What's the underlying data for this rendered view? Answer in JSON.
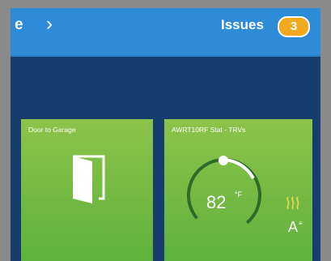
{
  "header": {
    "crumb_text": "e",
    "chevron": "›",
    "issues_label": "Issues",
    "issues_count": "3",
    "badge_color": "#f2a91e",
    "bar_color": "#2d8bd8"
  },
  "tiles": [
    {
      "title": "Door to Garage",
      "icon": "open-door-icon"
    },
    {
      "title": "AWRT10RF Stat - TRVs",
      "temperature": "82",
      "unit": "°F",
      "mode": "A",
      "mode_sup": "≡",
      "icons": [
        "thermostat-dial",
        "heating-icon",
        "auto-mode-icon"
      ]
    }
  ],
  "colors": {
    "tile_green": "#6cba3f",
    "background": "#173d6e"
  }
}
